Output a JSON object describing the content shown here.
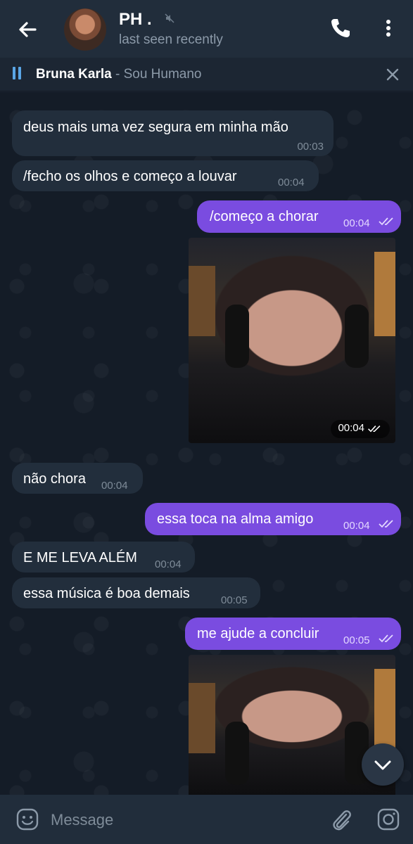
{
  "header": {
    "contact_name": "PH .",
    "status": "last seen recently"
  },
  "music": {
    "artist": "Bruna Karla",
    "separator": " - ",
    "song": "Sou Humano"
  },
  "messages": [
    {
      "dir": "in",
      "text": "deus mais uma vez segura em minha mão",
      "time": "00:03"
    },
    {
      "dir": "in",
      "text": "/fecho os olhos e começo a louvar",
      "time": "00:04"
    },
    {
      "dir": "out",
      "text": "/começo a chorar",
      "time": "00:04"
    },
    {
      "dir": "out",
      "type": "media",
      "time": "00:04"
    },
    {
      "dir": "in",
      "text": "não chora",
      "time": "00:04"
    },
    {
      "dir": "out",
      "text": "essa toca na alma amigo",
      "time": "00:04"
    },
    {
      "dir": "in",
      "text": "E ME LEVA ALÉM",
      "time": "00:04"
    },
    {
      "dir": "in",
      "text": "essa música é boa demais",
      "time": "00:05"
    },
    {
      "dir": "out",
      "text": "me ajude a concluir",
      "time": "00:05"
    },
    {
      "dir": "out",
      "type": "media",
      "time": ""
    }
  ],
  "composer": {
    "placeholder": "Message"
  },
  "icons": {
    "back": "arrow-left-icon",
    "call": "phone-icon",
    "more": "more-vertical-icon",
    "pause": "pause-icon",
    "close": "close-icon",
    "emoji": "emoji-icon",
    "attach": "paperclip-icon",
    "camera": "camera-icon",
    "scroll_down": "chevron-down-icon",
    "read": "double-check-icon"
  },
  "colors": {
    "outgoing_bubble": "#7a4ce0",
    "incoming_bubble": "#222e3c",
    "header_bg": "#212d3b",
    "accent": "#5aa6e6"
  }
}
